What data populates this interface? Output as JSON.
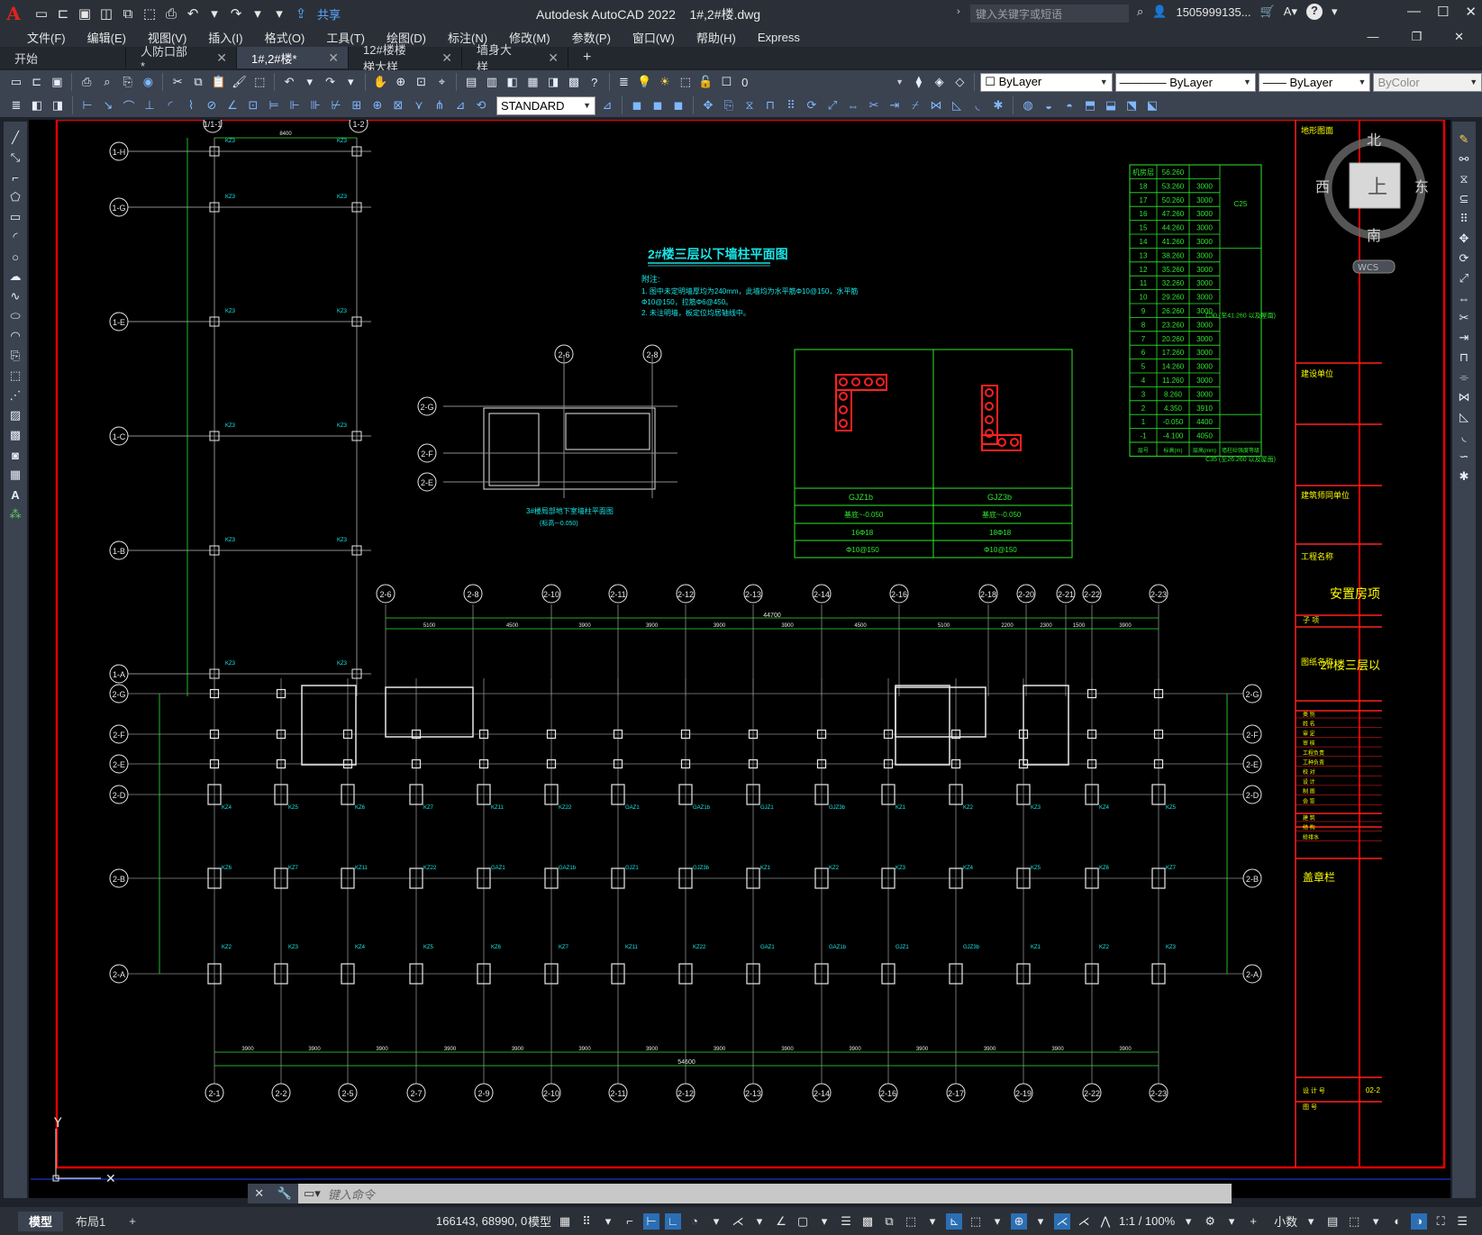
{
  "app": {
    "logo": "A",
    "title": "Autodesk AutoCAD 2022",
    "file": "1#,2#楼.dwg",
    "share": "共享",
    "search_placeholder": "键入关键字或短语",
    "user": "1505999135...",
    "help": "?"
  },
  "menu": [
    "文件(F)",
    "编辑(E)",
    "视图(V)",
    "插入(I)",
    "格式(O)",
    "工具(T)",
    "绘图(D)",
    "标注(N)",
    "修改(M)",
    "参数(P)",
    "窗口(W)",
    "帮助(H)",
    "Express"
  ],
  "tabs": [
    {
      "label": "开始",
      "closable": false
    },
    {
      "label": "人防口部*",
      "closable": true
    },
    {
      "label": "1#,2#楼*",
      "closable": true,
      "active": true
    },
    {
      "label": "12#楼楼梯大样",
      "closable": true
    },
    {
      "label": "墙身大样",
      "closable": true
    }
  ],
  "toolbar": {
    "layer": "0",
    "color": "ByLayer",
    "linetype": "ByLayer",
    "lineweight": "ByLayer",
    "plotstyle": "ByColor",
    "textstyle": "STANDARD"
  },
  "viewcube": {
    "north": "北",
    "south": "南",
    "east": "东",
    "west": "西",
    "top": "上",
    "wcs": "WCS"
  },
  "drawing": {
    "title": "2#楼三层以下墙柱平面图",
    "notes_title": "附注:",
    "notes": [
      "1. 图中未定明墙厚均为240mm，此墙均为水平筋Φ10@150，水平筋",
      "   Φ10@150，拉筋Φ6@450。",
      "2. 未注明墙，板定位均居轴线中。"
    ],
    "sub_plan_title": "3#楼局部地下室墙柱平面图",
    "sub_plan_sub": "(标高~-0.050)",
    "top_axes": [
      "1/1-1",
      "1-2"
    ],
    "left_axes": [
      "1-H",
      "1-G",
      "1-E",
      "1-C",
      "1-B",
      "1-A"
    ],
    "top_dim": "8400",
    "bottom_axes": [
      "2-1",
      "2-2",
      "2-5",
      "2-7",
      "2-9",
      "2-10",
      "2-11",
      "2-12",
      "2-13",
      "2-14",
      "2-16",
      "2-17",
      "2-19",
      "2-22",
      "2-23"
    ],
    "upper_axes": [
      "2-6",
      "2-8",
      "2-10",
      "2-11",
      "2-12",
      "2-13",
      "2-14",
      "2-16",
      "2-18",
      "2-20",
      "2-21",
      "2-22",
      "2-23"
    ],
    "row_axes": [
      "2-G",
      "2-F",
      "2-E",
      "2-D",
      "2-B",
      "2-A"
    ],
    "overall_top": "44700",
    "overall_bottom": "54600",
    "top_dims": [
      "5100",
      "4500",
      "3900",
      "3900",
      "3900",
      "3900",
      "4500",
      "5100",
      "2200",
      "2300",
      "1500",
      "3900"
    ],
    "bottom_dims": [
      "3900",
      "3900",
      "3900",
      "3900",
      "3900",
      "3900",
      "3900",
      "3900",
      "3900",
      "3900",
      "3900",
      "3900",
      "3900",
      "3900"
    ],
    "column_tags": [
      "KZ1",
      "KZ2",
      "KZ3",
      "KZ4",
      "KZ5",
      "KZ6",
      "KZ7",
      "KZ11",
      "KZ22",
      "GAZ1",
      "GAZ1b",
      "GJZ1",
      "GJZ3b"
    ],
    "detail_table": {
      "cols": [
        "GJZ1b",
        "GJZ3b"
      ],
      "rows": [
        [
          "基底~-0.050",
          "基底~-0.050"
        ],
        [
          "16Φ18",
          "18Φ18"
        ],
        [
          "Φ10@150",
          "Φ10@150"
        ]
      ]
    },
    "floor_table": {
      "rows": [
        [
          "机房层",
          "56.260",
          ""
        ],
        [
          "18",
          "53.260",
          "3000"
        ],
        [
          "17",
          "50.260",
          "3000"
        ],
        [
          "16",
          "47.260",
          "3000"
        ],
        [
          "15",
          "44.260",
          "3000"
        ],
        [
          "14",
          "41.260",
          "3000"
        ],
        [
          "13",
          "38.260",
          "3000"
        ],
        [
          "12",
          "35.260",
          "3000"
        ],
        [
          "11",
          "32.260",
          "3000"
        ],
        [
          "10",
          "29.260",
          "3000"
        ],
        [
          "9",
          "26.260",
          "3000"
        ],
        [
          "8",
          "23.260",
          "3000"
        ],
        [
          "7",
          "20.260",
          "3000"
        ],
        [
          "6",
          "17.260",
          "3000"
        ],
        [
          "5",
          "14.260",
          "3000"
        ],
        [
          "4",
          "11.260",
          "3000"
        ],
        [
          "3",
          "8.260",
          "3000"
        ],
        [
          "2",
          "4.350",
          "3910"
        ],
        [
          "1",
          "-0.050",
          "4400"
        ],
        [
          "-1",
          "-4.100",
          "4050"
        ]
      ],
      "footer": [
        "层号",
        "标高(m)",
        "层高(mm)",
        "墙柱砼强度等级"
      ],
      "grades": [
        "C25",
        "C30 (至41.260 以及屋面)",
        "C35 (至26.260 以及屋面)"
      ]
    },
    "title_block": {
      "sections": [
        "地形图面",
        "建设单位",
        "建筑师同单位",
        "工程名称",
        "图纸名称"
      ],
      "project": "安置房项",
      "sub": "子 项",
      "drawing_name": "2#楼三层以",
      "roles": [
        "类 别",
        "姓 名",
        "审 定",
        "审 核",
        "工程负责",
        "工种负责",
        "校 对",
        "设 计",
        "制 图",
        "会 签",
        "建 筑",
        "结 构",
        "给排水"
      ],
      "stamp": "盖章栏",
      "design_no_label": "设 计 号",
      "design_no": "02-2",
      "drawing_no_label": "图 号"
    }
  },
  "command": {
    "placeholder": "键入命令"
  },
  "status": {
    "tabs": [
      "模型",
      "布局1"
    ],
    "coords": "166143, 68990, 0",
    "model": "模型",
    "scale": "1:1 / 100%",
    "units": "小数"
  },
  "colors": {
    "bg": "#000000",
    "border": "#e30000",
    "green": "#2ee62e",
    "cyan": "#19e6e6",
    "white": "#e8e8e8",
    "yellow": "#ffff00",
    "red": "#ff2020",
    "grey": "#8c8c8c"
  }
}
